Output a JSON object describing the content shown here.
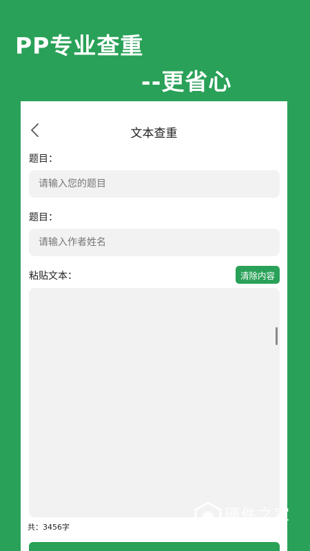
{
  "promo": {
    "line1": "PP专业查重",
    "line2": "--更省心"
  },
  "header": {
    "title": "文本查重",
    "back_icon": "chevron-left-icon"
  },
  "form": {
    "title_label": "题目：",
    "title_placeholder": "请输入您的题目",
    "author_label": "题目：",
    "author_placeholder": "请输入作者姓名",
    "paste_label": "粘贴文本：",
    "clear_button": "清除内容",
    "paste_value": "",
    "count_text": "共：3456字"
  },
  "watermark": {
    "title": "硬件之家",
    "subtitle": "YING JIAN ZHI JIA.COM"
  },
  "colors": {
    "brand_green": "#2aa158",
    "input_bg": "#f2f2f2"
  }
}
